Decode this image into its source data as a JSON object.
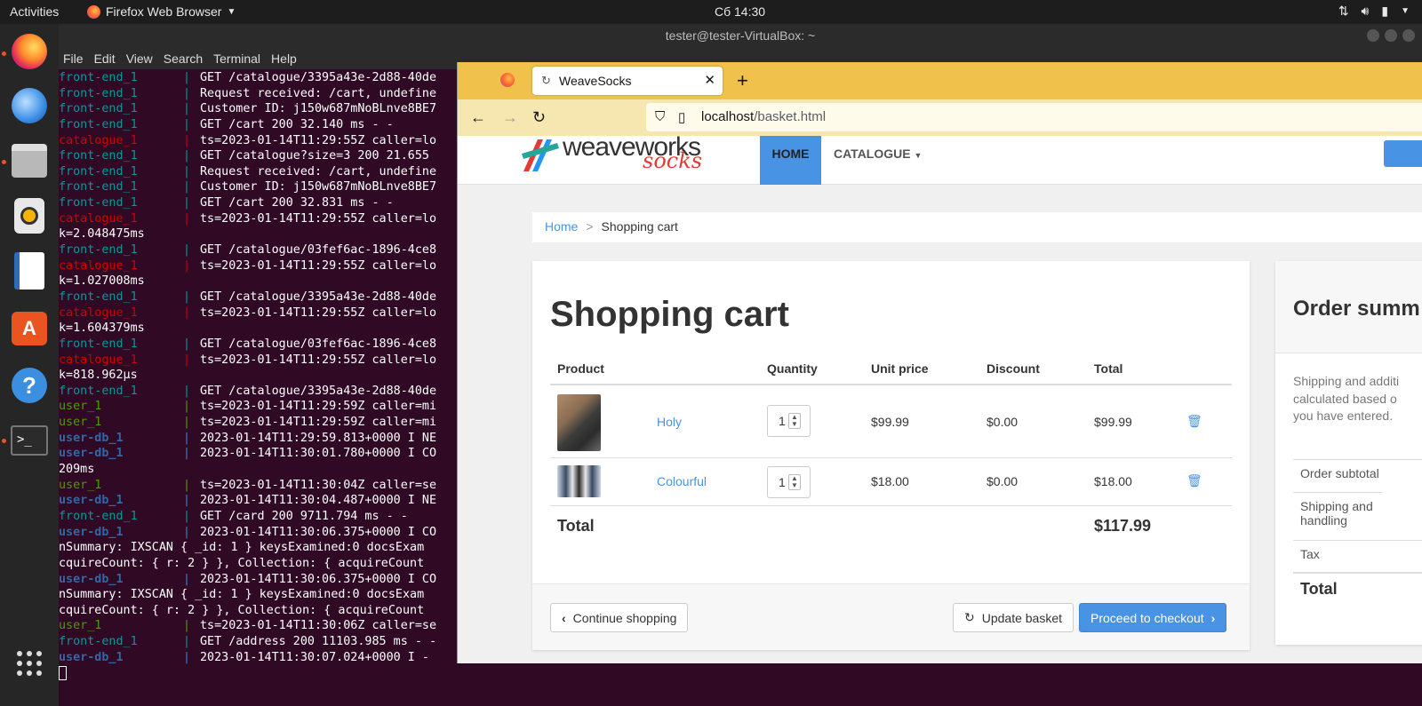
{
  "topbar": {
    "activities": "Activities",
    "app_name": "Firefox Web Browser",
    "clock": "Сб 14:30"
  },
  "terminal": {
    "title": "tester@tester-VirtualBox: ~",
    "menu": [
      "File",
      "Edit",
      "View",
      "Search",
      "Terminal",
      "Help"
    ],
    "lines": [
      {
        "svc": "front-end_1",
        "cls": "c-fe",
        "text": "GET /catalogue/3395a43e-2d88-40de"
      },
      {
        "svc": "front-end_1",
        "cls": "c-fe",
        "text": "Request received: /cart, undefine"
      },
      {
        "svc": "front-end_1",
        "cls": "c-fe",
        "text": "Customer ID: j150w687mNoBLnve8BE7"
      },
      {
        "svc": "front-end_1",
        "cls": "c-fe",
        "text": "GET /cart 200 32.140 ms - -"
      },
      {
        "svc": "catalogue_1",
        "cls": "c-cat",
        "text": "ts=2023-01-14T11:29:55Z caller=lo"
      },
      {
        "svc": "front-end_1",
        "cls": "c-fe",
        "text": "GET /catalogue?size=3 200 21.655"
      },
      {
        "svc": "front-end_1",
        "cls": "c-fe",
        "text": "Request received: /cart, undefine"
      },
      {
        "svc": "front-end_1",
        "cls": "c-fe",
        "text": "Customer ID: j150w687mNoBLnve8BE7"
      },
      {
        "svc": "front-end_1",
        "cls": "c-fe",
        "text": "GET /cart 200 32.831 ms - -"
      },
      {
        "svc": "catalogue_1",
        "cls": "c-cat",
        "text": "ts=2023-01-14T11:29:55Z caller=lo"
      },
      {
        "svc": "",
        "cls": "",
        "text": "k=2.048475ms"
      },
      {
        "svc": "front-end_1",
        "cls": "c-fe",
        "text": "GET /catalogue/03fef6ac-1896-4ce8"
      },
      {
        "svc": "catalogue_1",
        "cls": "c-cat",
        "text": "ts=2023-01-14T11:29:55Z caller=lo"
      },
      {
        "svc": "",
        "cls": "",
        "text": "k=1.027008ms"
      },
      {
        "svc": "front-end_1",
        "cls": "c-fe",
        "text": "GET /catalogue/3395a43e-2d88-40de"
      },
      {
        "svc": "catalogue_1",
        "cls": "c-cat",
        "text": "ts=2023-01-14T11:29:55Z caller=lo"
      },
      {
        "svc": "",
        "cls": "",
        "text": "k=1.604379ms"
      },
      {
        "svc": "front-end_1",
        "cls": "c-fe",
        "text": "GET /catalogue/03fef6ac-1896-4ce8"
      },
      {
        "svc": "catalogue_1",
        "cls": "c-cat",
        "text": "ts=2023-01-14T11:29:55Z caller=lo"
      },
      {
        "svc": "",
        "cls": "",
        "text": "k=818.962µs"
      },
      {
        "svc": "front-end_1",
        "cls": "c-fe",
        "text": "GET /catalogue/3395a43e-2d88-40de"
      },
      {
        "svc": "user_1",
        "cls": "c-user",
        "text": "ts=2023-01-14T11:29:59Z caller=mi"
      },
      {
        "svc": "user_1",
        "cls": "c-user",
        "text": "ts=2023-01-14T11:29:59Z caller=mi"
      },
      {
        "svc": "user-db_1",
        "cls": "c-udb",
        "text": "2023-01-14T11:29:59.813+0000 I NE"
      },
      {
        "svc": "user-db_1",
        "cls": "c-udb",
        "text": "2023-01-14T11:30:01.780+0000 I CO"
      },
      {
        "svc": "",
        "cls": "",
        "text": "209ms"
      },
      {
        "svc": "user_1",
        "cls": "c-user",
        "text": "ts=2023-01-14T11:30:04Z caller=se"
      },
      {
        "svc": "user-db_1",
        "cls": "c-udb",
        "text": "2023-01-14T11:30:04.487+0000 I NE"
      },
      {
        "svc": "front-end_1",
        "cls": "c-fe",
        "text": "GET /card 200 9711.794 ms - -"
      },
      {
        "svc": "user-db_1",
        "cls": "c-udb",
        "text": "2023-01-14T11:30:06.375+0000 I CO"
      },
      {
        "svc": "",
        "cls": "",
        "text": "nSummary: IXSCAN { _id: 1 } keysExamined:0 docsExam"
      },
      {
        "svc": "",
        "cls": "",
        "text": "cquireCount: { r: 2 } }, Collection: { acquireCount"
      },
      {
        "svc": "user-db_1",
        "cls": "c-udb",
        "text": "2023-01-14T11:30:06.375+0000 I CO"
      },
      {
        "svc": "",
        "cls": "",
        "text": "nSummary: IXSCAN { _id: 1 } keysExamined:0 docsExam"
      },
      {
        "svc": "",
        "cls": "",
        "text": "cquireCount: { r: 2 } }, Collection: { acquireCount"
      },
      {
        "svc": "user_1",
        "cls": "c-user",
        "text": "ts=2023-01-14T11:30:06Z caller=se"
      },
      {
        "svc": "front-end_1",
        "cls": "c-fe",
        "text": "GET /address 200 11103.985 ms - -"
      },
      {
        "svc": "user-db_1",
        "cls": "c-udb",
        "text": "2023-01-14T11:30:07.024+0000 I -"
      }
    ]
  },
  "browser": {
    "tab_title": "WeaveSocks",
    "url_host": "localhost",
    "url_path": "/basket.html"
  },
  "site": {
    "logo_text": "weaveworks",
    "logo_sub": "socks",
    "nav_home": "HOME",
    "nav_catalogue": "CATALOGUE",
    "breadcrumb_home": "Home",
    "breadcrumb_current": "Shopping cart",
    "cart_title": "Shopping cart",
    "table_headers": {
      "product": "Product",
      "quantity": "Quantity",
      "unit_price": "Unit price",
      "discount": "Discount",
      "total": "Total"
    },
    "items": [
      {
        "name": "Holy",
        "qty": "1",
        "unit_price": "$99.99",
        "discount": "$0.00",
        "total": "$99.99"
      },
      {
        "name": "Colourful",
        "qty": "1",
        "unit_price": "$18.00",
        "discount": "$0.00",
        "total": "$18.00"
      }
    ],
    "total_label": "Total",
    "total_value": "$117.99",
    "btn_continue": "Continue shopping",
    "btn_update": "Update basket",
    "btn_checkout": "Proceed to checkout",
    "summary_title": "Order summ",
    "summary_note": "Shipping and additi calculated based o you have entered.",
    "summary_rows": {
      "subtotal": "Order subtotal",
      "shipping": "Shipping and handling",
      "tax": "Tax",
      "total": "Total"
    }
  }
}
